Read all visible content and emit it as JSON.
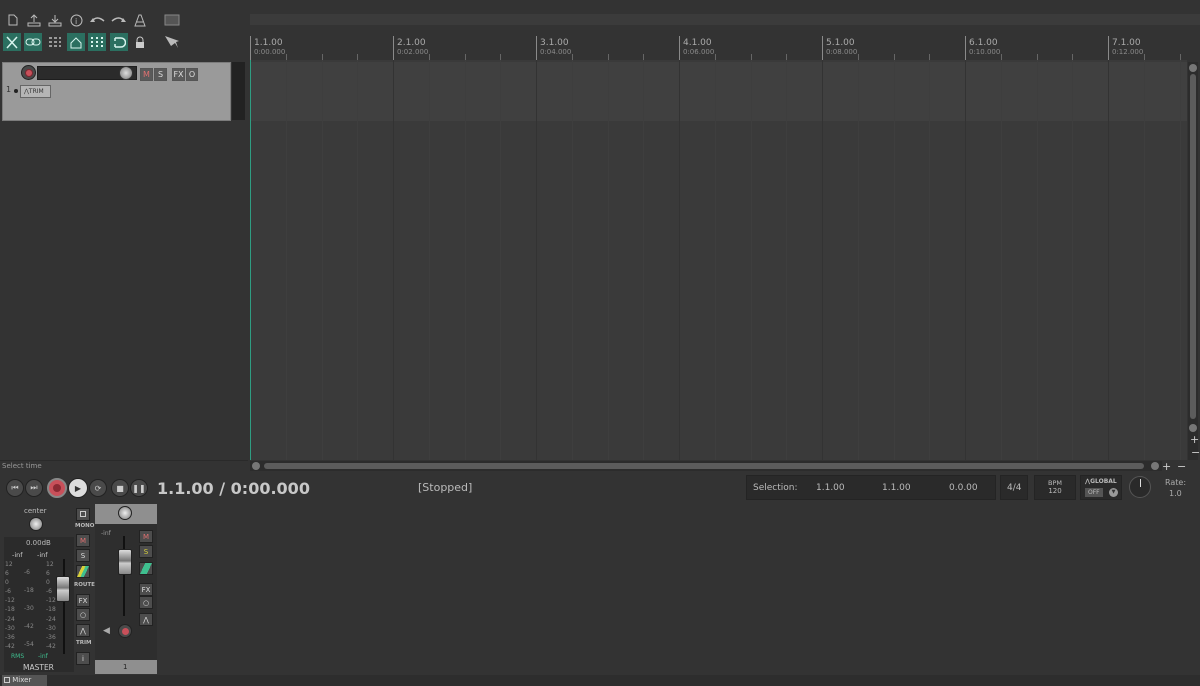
{
  "toolbar": {
    "icons": [
      "new-project-icon",
      "open-project-icon",
      "save-project-icon",
      "project-info-icon",
      "undo-icon",
      "redo-icon",
      "metronome-icon",
      "grid-settings-icon",
      "ripple-edit-icon",
      "item-grouping-icon",
      "envelope-icon",
      "autocrossfade-icon",
      "grid-icon",
      "snap-icon",
      "lock-icon",
      "media-explorer-icon"
    ]
  },
  "track": {
    "number": "1",
    "trim_label": "TRIM",
    "mute": "M",
    "solo": "S",
    "fx": "FX",
    "io": "O"
  },
  "ruler": {
    "markers": [
      {
        "bar": "1.1.00",
        "time": "0:00.000"
      },
      {
        "bar": "2.1.00",
        "time": "0:02.000"
      },
      {
        "bar": "3.1.00",
        "time": "0:04.000"
      },
      {
        "bar": "4.1.00",
        "time": "0:06.000"
      },
      {
        "bar": "5.1.00",
        "time": "0:08.000"
      },
      {
        "bar": "6.1.00",
        "time": "0:10.000"
      },
      {
        "bar": "7.1.00",
        "time": "0:12.000"
      }
    ]
  },
  "status_hint": "Select time",
  "transport": {
    "position": "1.1.00 / 0:00.000",
    "state": "[Stopped]",
    "selection_label": "Selection:",
    "selection_start": "1.1.00",
    "selection_end": "1.1.00",
    "selection_length": "0.0.00",
    "time_signature": "4/4",
    "bpm_label": "BPM",
    "bpm_value": "120",
    "global_label": "GLOBAL",
    "global_state": "OFF",
    "rate_label": "Rate:",
    "rate_value": "1.0"
  },
  "master": {
    "pan_label": "center",
    "volume": "0.00dB",
    "peak_left": "-inf",
    "peak_right": "-inf",
    "mono": "MONO",
    "mute": "M",
    "solo": "S",
    "route": "ROUTE",
    "fx": "FX",
    "trim": "TRIM",
    "info": "i",
    "rms_label": "RMS",
    "rms_value": "-inf",
    "name": "MASTER",
    "scale_left": [
      "12",
      "6",
      "0",
      "-6",
      "-12",
      "-18",
      "-24",
      "-30",
      "-36",
      "-42"
    ],
    "scale_mid": [
      "-6",
      "-18",
      "-30",
      "-42",
      "-54"
    ],
    "scale_right": [
      "12",
      "6",
      "0",
      "-6",
      "-12",
      "-18",
      "-24",
      "-30",
      "-36",
      "-42"
    ]
  },
  "channel": {
    "peak": "-inf",
    "mute": "M",
    "solo": "S",
    "fx": "FX",
    "number": "1"
  },
  "mixer_tab": "Mixer",
  "colors": {
    "accent": "#2b6f60",
    "record": "#c8505a",
    "meter_text": "#3fbf8f"
  }
}
